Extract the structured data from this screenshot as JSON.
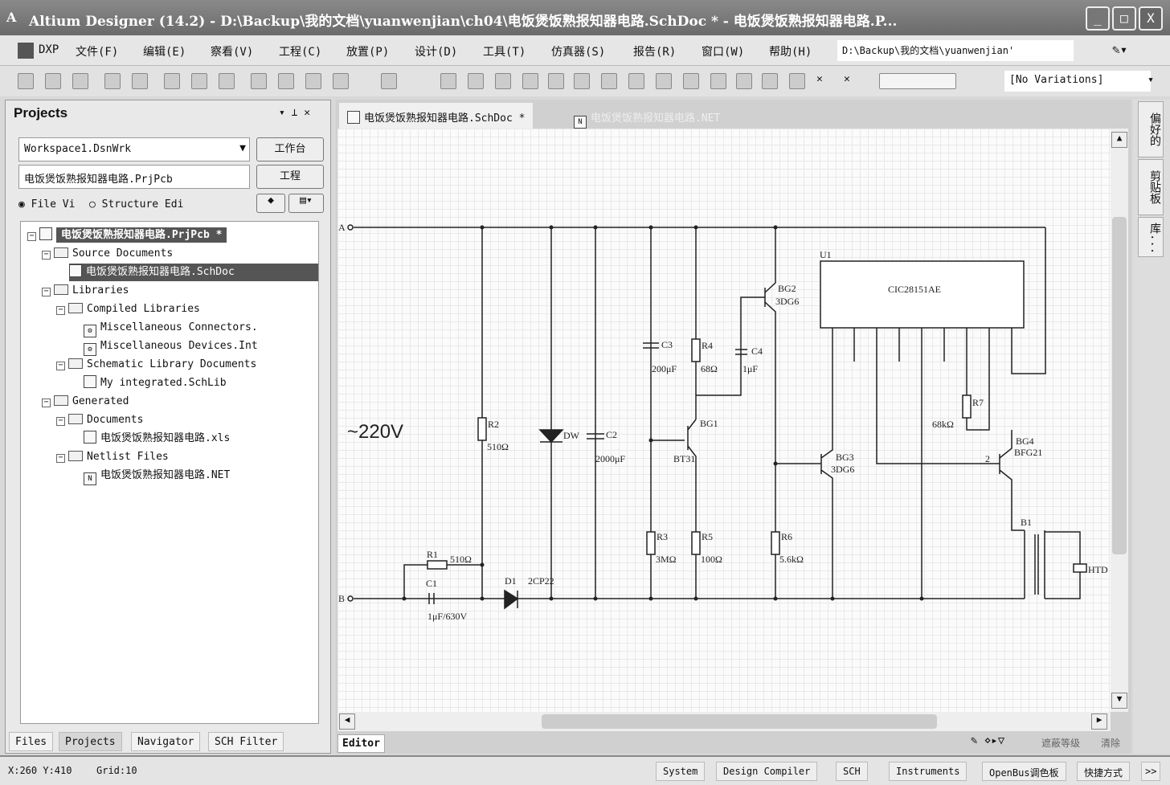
{
  "title": "Altium Designer (14.2) - D:\\Backup\\我的文档\\yuanwenjian\\ch04\\电饭煲饭熟报知器电路.SchDoc * - 电饭煲饭熟报知器电路.P...",
  "window_buttons": {
    "minimize": "_",
    "maximize": "□",
    "close": "X"
  },
  "menu": [
    "DXP",
    "文件(F)",
    "编辑(E)",
    "察看(V)",
    "工程(C)",
    "放置(P)",
    "设计(D)",
    "工具(T)",
    "仿真器(S)",
    "报告(R)",
    "窗口(W)",
    "帮助(H)"
  ],
  "path_dropdown": "D:\\Backup\\我的文档\\yuanwenjian'",
  "variations": "[No Variations]",
  "projects_panel": {
    "title": "Projects",
    "workspace": "Workspace1.DsnWrk",
    "workspace_button": "工作台",
    "project": "电饭煲饭熟报知器电路.PrjPcb",
    "project_button": "工程",
    "radio_file": "File Vi",
    "radio_structure": "Structure Edi",
    "tree": [
      "电饭煲饭熟报知器电路.PrjPcb *",
      "Source Documents",
      "电饭煲饭熟报知器电路.SchDoc",
      "Libraries",
      "Compiled Libraries",
      "Miscellaneous Connectors.",
      "Miscellaneous Devices.Int",
      "Schematic Library Documents",
      "My integrated.SchLib",
      "Generated",
      "Documents",
      "电饭煲饭熟报知器电路.xls",
      "Netlist Files",
      "电饭煲饭熟报知器电路.NET"
    ],
    "tabs": [
      "Files",
      "Projects",
      "Navigator",
      "SCH Filter"
    ]
  },
  "doc_tabs": [
    "电饭煲饭熟报知器电路.SchDoc *",
    "电饭煲饭熟报知器电路.NET"
  ],
  "right_tabs": [
    "偏好的",
    "剪贴板",
    "库..."
  ],
  "editor_tab": "Editor",
  "mask_level": "遮蔽等级",
  "clear": "清除",
  "schematic": {
    "voltage": "~220V",
    "A": "A",
    "B": "B",
    "R1": "R1",
    "R1v": "510Ω",
    "C1": "C1",
    "C1v": "1μF/630V",
    "D1": "D1",
    "D1v": "2CP22",
    "R2": "R2",
    "R2v": "510Ω",
    "DW": "DW",
    "C2": "C2",
    "C2v": "2000μF",
    "C3": "C3",
    "C3v": "200μF",
    "R4": "R4",
    "R4v": "68Ω",
    "C4": "C4",
    "C4v": "1μF",
    "BG1": "BG1",
    "BG1v": "BT31",
    "BG2": "BG2",
    "BG2v": "3DG6",
    "BG3": "BG3",
    "BG3v": "3DG6",
    "R3": "R3",
    "R3v": "3MΩ",
    "R5": "R5",
    "R5v": "100Ω",
    "R6": "R6",
    "R6v": "5.6kΩ",
    "U1": "U1",
    "U1v": "CIC28151AE",
    "R7": "R7",
    "R7v": "68kΩ",
    "BG4": "BG4",
    "BG4v": "BFG21",
    "BG4pin": "2",
    "B1": "B1",
    "HTD": "HTD"
  },
  "status": {
    "coords": "X:260 Y:410",
    "grid": "Grid:10",
    "buttons": [
      "System",
      "Design Compiler",
      "SCH",
      "Instruments",
      "OpenBus调色板",
      "快捷方式",
      ">>"
    ]
  }
}
